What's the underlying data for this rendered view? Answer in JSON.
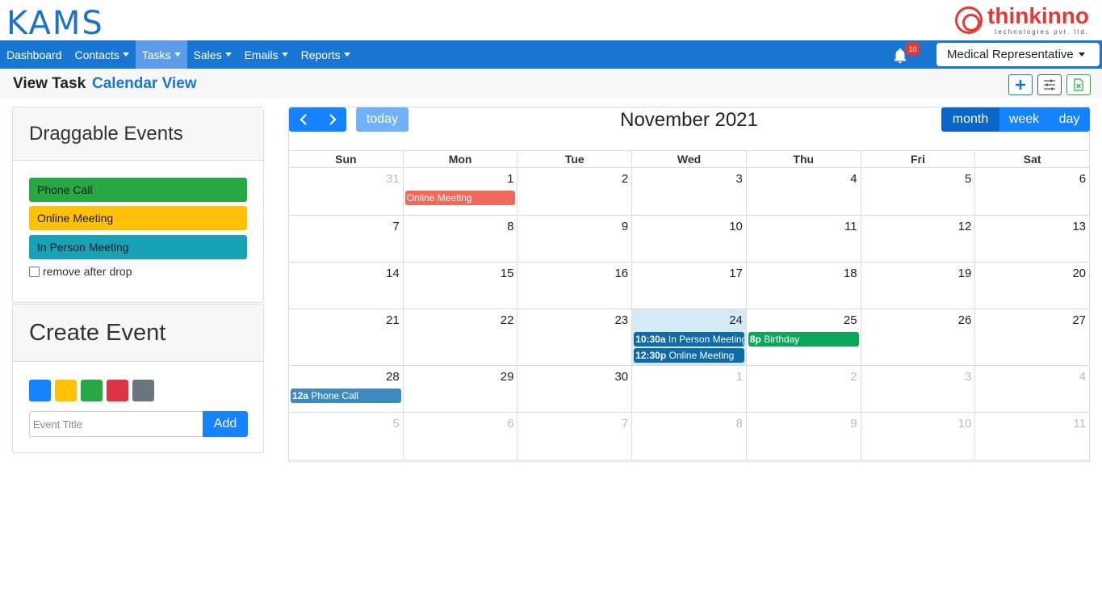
{
  "header": {
    "logo": "KAMS",
    "brand_name": "thinkinno",
    "brand_sub": "technologies pvt. ltd."
  },
  "nav": {
    "items": [
      {
        "label": "Dashboard",
        "dropdown": false
      },
      {
        "label": "Contacts",
        "dropdown": true
      },
      {
        "label": "Tasks",
        "dropdown": true,
        "active": true
      },
      {
        "label": "Sales",
        "dropdown": true
      },
      {
        "label": "Emails",
        "dropdown": true
      },
      {
        "label": "Reports",
        "dropdown": true
      }
    ],
    "notification_icon": "bell-icon",
    "notification_count": "10",
    "role": "Medical Representative"
  },
  "subheader": {
    "title": "View Task",
    "link": "Calendar View",
    "actions": [
      "plus-icon",
      "sliders-icon",
      "excel-icon"
    ]
  },
  "draggable": {
    "title": "Draggable Events",
    "events": [
      {
        "label": "Phone Call",
        "color": "#28a745"
      },
      {
        "label": "Online Meeting",
        "color": "#ffc107"
      },
      {
        "label": "In Person Meeting",
        "color": "#17a2b8"
      }
    ],
    "remove_label": "remove after drop"
  },
  "create": {
    "title": "Create Event",
    "colors": [
      "#1583ff",
      "#ffc107",
      "#28a745",
      "#dc3545",
      "#6c757d"
    ],
    "placeholder": "Event Title",
    "add_label": "Add"
  },
  "calendar": {
    "prev_icon": "chevron-left-icon",
    "next_icon": "chevron-right-icon",
    "prev_glyph": "‹",
    "next_glyph": "›",
    "today_label": "today",
    "title": "November 2021",
    "views": [
      "month",
      "week",
      "day"
    ],
    "active_view": "month",
    "days_of_week": [
      "Sun",
      "Mon",
      "Tue",
      "Wed",
      "Thu",
      "Fri",
      "Sat"
    ],
    "weeks": [
      [
        {
          "d": "31",
          "other": true
        },
        {
          "d": "1"
        },
        {
          "d": "2"
        },
        {
          "d": "3"
        },
        {
          "d": "4"
        },
        {
          "d": "5"
        },
        {
          "d": "6"
        }
      ],
      [
        {
          "d": "7"
        },
        {
          "d": "8"
        },
        {
          "d": "9"
        },
        {
          "d": "10"
        },
        {
          "d": "11"
        },
        {
          "d": "12"
        },
        {
          "d": "13"
        }
      ],
      [
        {
          "d": "14"
        },
        {
          "d": "15"
        },
        {
          "d": "16"
        },
        {
          "d": "17"
        },
        {
          "d": "18"
        },
        {
          "d": "19"
        },
        {
          "d": "20"
        }
      ],
      [
        {
          "d": "21"
        },
        {
          "d": "22"
        },
        {
          "d": "23"
        },
        {
          "d": "24",
          "today": true
        },
        {
          "d": "25"
        },
        {
          "d": "26"
        },
        {
          "d": "27"
        }
      ],
      [
        {
          "d": "28"
        },
        {
          "d": "29"
        },
        {
          "d": "30"
        },
        {
          "d": "1",
          "other": true
        },
        {
          "d": "2",
          "other": true
        },
        {
          "d": "3",
          "other": true
        },
        {
          "d": "4",
          "other": true
        }
      ],
      [
        {
          "d": "5",
          "other": true
        },
        {
          "d": "6",
          "other": true
        },
        {
          "d": "7",
          "other": true
        },
        {
          "d": "8",
          "other": true
        },
        {
          "d": "9",
          "other": true
        },
        {
          "d": "10",
          "other": true
        },
        {
          "d": "11",
          "other": true
        }
      ]
    ],
    "events": [
      {
        "week": 0,
        "day": 1,
        "slot": 0,
        "time": "",
        "title": "Online Meeting",
        "color": "#f0695a"
      },
      {
        "week": 3,
        "day": 3,
        "slot": 0,
        "time": "10:30a",
        "title": "In Person Meeting",
        "color": "#0f6aa8"
      },
      {
        "week": 3,
        "day": 3,
        "slot": 1,
        "time": "12:30p",
        "title": "Online Meeting",
        "color": "#0f6aa8"
      },
      {
        "week": 3,
        "day": 4,
        "slot": 0,
        "time": "8p",
        "title": "Birthday",
        "color": "#0ba85b"
      },
      {
        "week": 4,
        "day": 0,
        "slot": 0,
        "time": "12a",
        "title": "Phone Call",
        "color": "#3d8ac0"
      }
    ]
  }
}
